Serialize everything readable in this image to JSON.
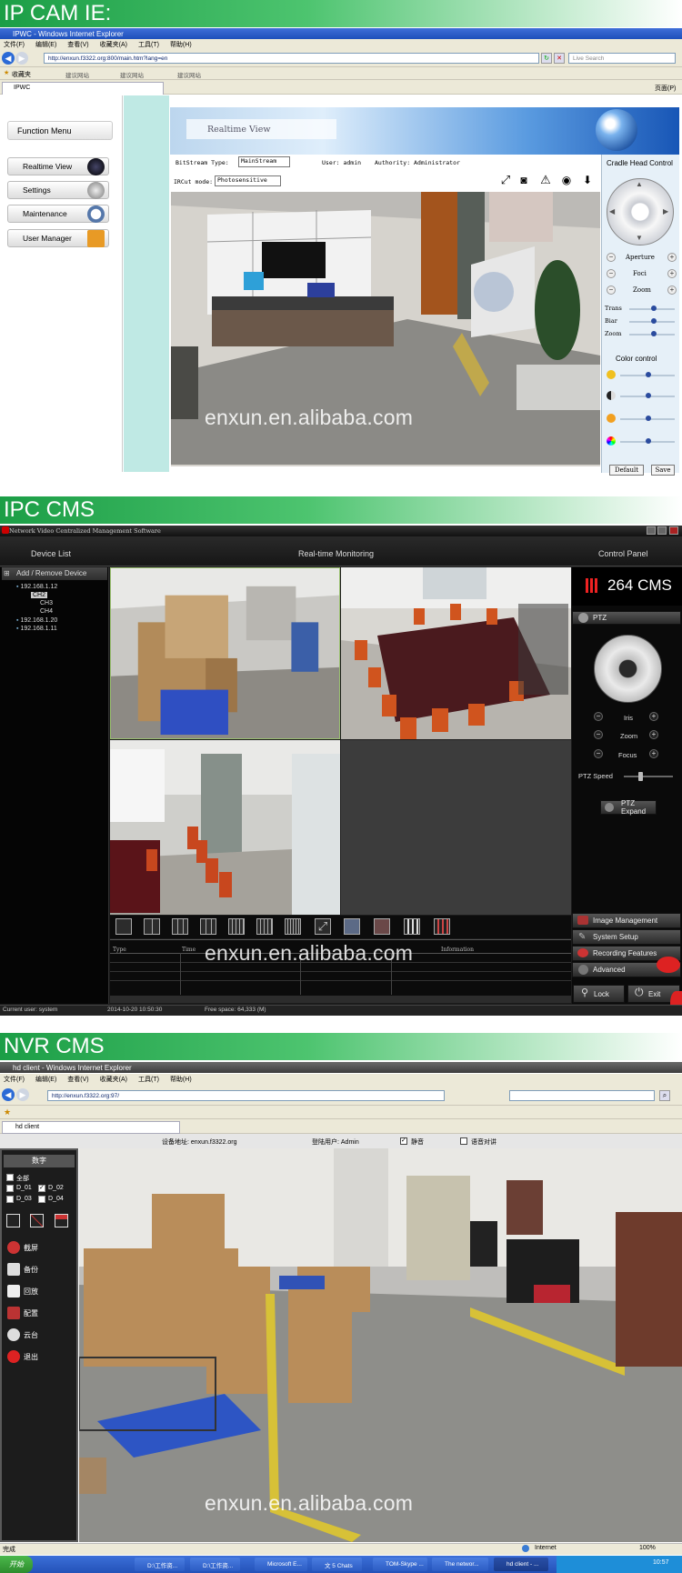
{
  "sections": {
    "ipcam": "IP CAM IE:",
    "ipccms": "IPC CMS",
    "nvrcms": "NVR CMS"
  },
  "watermark": "enxun.en.alibaba.com",
  "ie1": {
    "title": "IPWC - Windows Internet Explorer",
    "menu": [
      "文件(F)",
      "编辑(E)",
      "查看(V)",
      "收藏夹(A)",
      "工具(T)",
      "帮助(H)"
    ],
    "address": "http://enxun.f3322.org:800/main.htm?lang=en",
    "search_placeholder": "Live Search",
    "favorites": "收藏夹",
    "fav_links": [
      "建议网站",
      "建议网站",
      "建议网站"
    ],
    "tab": "IPWC",
    "page_menu": "页面(P)",
    "function_menu": "Function Menu",
    "menu_items": [
      "Realtime View",
      "Settings",
      "Maintenance",
      "User Manager"
    ],
    "realtime_title": "Realtime View",
    "bitstream_label": "BitStream Type:",
    "bitstream_value": "MainStream",
    "user": "User: admin",
    "authority": "Authority: Administrator",
    "ircut_label": "IRCut mode:",
    "ircut_value": "Photosensitive",
    "cradle_title": "Cradle Head Control",
    "ptz": [
      "Aperture",
      "Foci",
      "Zoom"
    ],
    "trans": [
      "Trans",
      "Biar",
      "Zoom"
    ],
    "color_title": "Color control",
    "default_btn": "Default",
    "save_btn": "Save"
  },
  "cms": {
    "title": "Network Video Centralized Management Software",
    "device_list": "Device List",
    "realtime": "Real-time Monitoring",
    "control_panel": "Control Panel",
    "add_remove": "Add / Remove Device",
    "tree": [
      "192.168.1.12",
      "CH2",
      "CH3",
      "CH4",
      "192.168.1.20",
      "192.168.1.11"
    ],
    "brand": "264 CMS",
    "ptz": "PTZ",
    "iris": "Iris",
    "zoom": "Zoom",
    "focus": "Focus",
    "ptz_speed": "PTZ Speed",
    "ptz_expand": "PTZ Expand",
    "log_cols": [
      "Type",
      "Time",
      "",
      "",
      "Information"
    ],
    "buttons": [
      "Image Management",
      "System Setup",
      "Recording Features",
      "Advanced"
    ],
    "lock": "Lock",
    "exit": "Exit",
    "status": [
      "Current user: system",
      "2014-10-20 10:50:30",
      "Free space: 64,333 (M)"
    ]
  },
  "ie2": {
    "title": "hd client - Windows Internet Explorer",
    "menu": [
      "文件(F)",
      "编辑(E)",
      "查看(V)",
      "收藏夹(A)",
      "工具(T)",
      "帮助(H)"
    ],
    "address": "http://enxun.f3322.org:97/",
    "tab": "hd client",
    "device_addr": "设备地址: enxun.f3322.org",
    "login_user": "登陆用户: Admin",
    "mute": "静音",
    "voice": "语音对讲",
    "panel_title": "数字",
    "select_all": "全部",
    "channels": [
      "D_01",
      "D_02",
      "D_03",
      "D_04"
    ],
    "side_items": [
      "截屏",
      "备份",
      "回放",
      "配置",
      "云台",
      "退出"
    ],
    "status_done": "完成",
    "internet": "Internet",
    "zoom": "100%",
    "start": "开始",
    "tasks": [
      "D:\\工作资...",
      "D:\\工作资...",
      "Microsoft E...",
      "文 5 Chats",
      "TOM-Skype ...",
      "The networ...",
      "hd client - ..."
    ],
    "clock": "10:57"
  }
}
